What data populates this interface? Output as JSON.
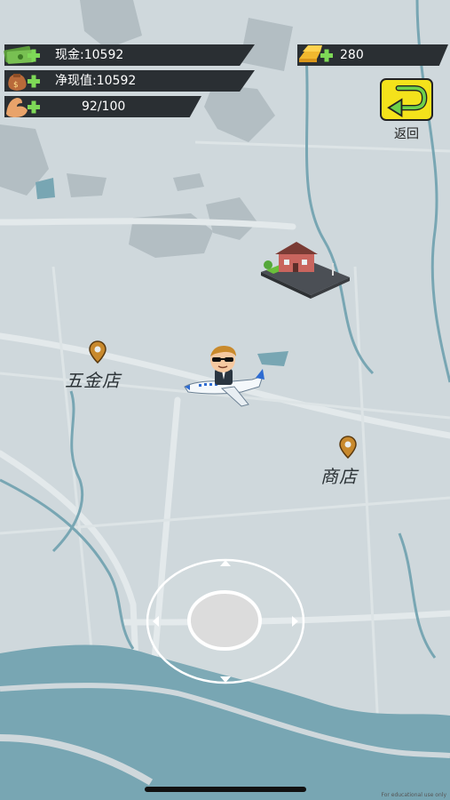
{
  "hud": {
    "cash": "现金:10592",
    "net_worth": "净现值:10592",
    "energy": "92/100",
    "gold": "280"
  },
  "return_button": {
    "label": "返回"
  },
  "places": [
    {
      "name": "五金店"
    },
    {
      "name": "商店"
    }
  ],
  "credit": "For educational use only",
  "colors": {
    "map_land": "#cfd8dc",
    "water": "#78a6b3",
    "hud_bar": "#2a2f33",
    "return_button": "#f4e21b",
    "pin": "#c8892d"
  }
}
